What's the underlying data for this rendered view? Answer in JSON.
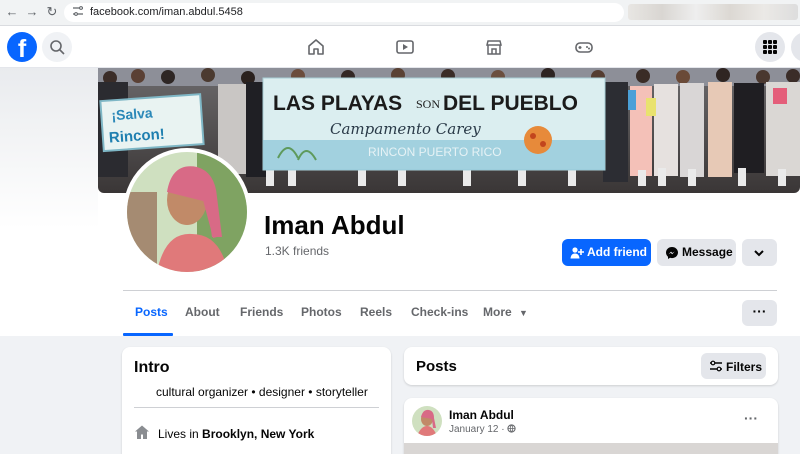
{
  "browser": {
    "url": "facebook.com/iman.abdul.5458"
  },
  "profile": {
    "name": "Iman Abdul",
    "friends_count": "1.3K friends",
    "cover_banner_line1": "LAS PLAYAS",
    "cover_banner_son": "SON",
    "cover_banner_line1b": "DEL PUEBLO",
    "cover_banner_line2": "Campamento Carey",
    "cover_banner_line3": "RINCON PUERTO RICO",
    "cover_sign_text_1": "¡Salva",
    "cover_sign_text_2": "Rincon!"
  },
  "actions": {
    "add_friend": "Add friend",
    "message": "Message"
  },
  "tabs": [
    {
      "label": "Posts"
    },
    {
      "label": "About"
    },
    {
      "label": "Friends"
    },
    {
      "label": "Photos"
    },
    {
      "label": "Reels"
    },
    {
      "label": "Check-ins"
    },
    {
      "label": "More"
    }
  ],
  "intro": {
    "title": "Intro",
    "bio": "cultural organizer • designer • storyteller",
    "lives_prefix": "Lives in",
    "lives_place": "Brooklyn, New York"
  },
  "posts_section": {
    "title": "Posts",
    "filters_label": "Filters"
  },
  "post": {
    "author": "Iman Abdul",
    "date": "January 12 ·"
  },
  "colors": {
    "brand_blue": "#0866ff",
    "page_bg": "#f0f2f5",
    "button_gray": "#e4e6eb"
  }
}
